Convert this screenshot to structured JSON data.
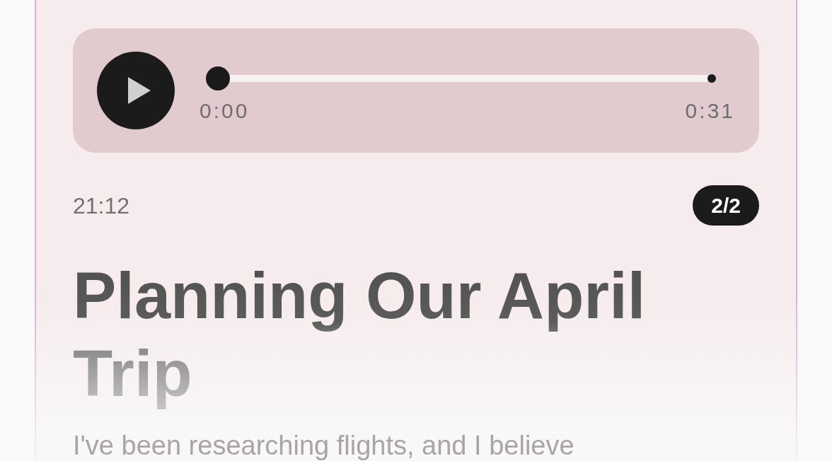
{
  "player": {
    "playing": false,
    "progress": {
      "level": 0
    },
    "elapsed": "0:00",
    "duration": "0:31"
  },
  "message": {
    "time": "21:12",
    "counter": "2/2",
    "title": "Planning Our April Trip",
    "body": "I've been researching flights, and I believe"
  }
}
